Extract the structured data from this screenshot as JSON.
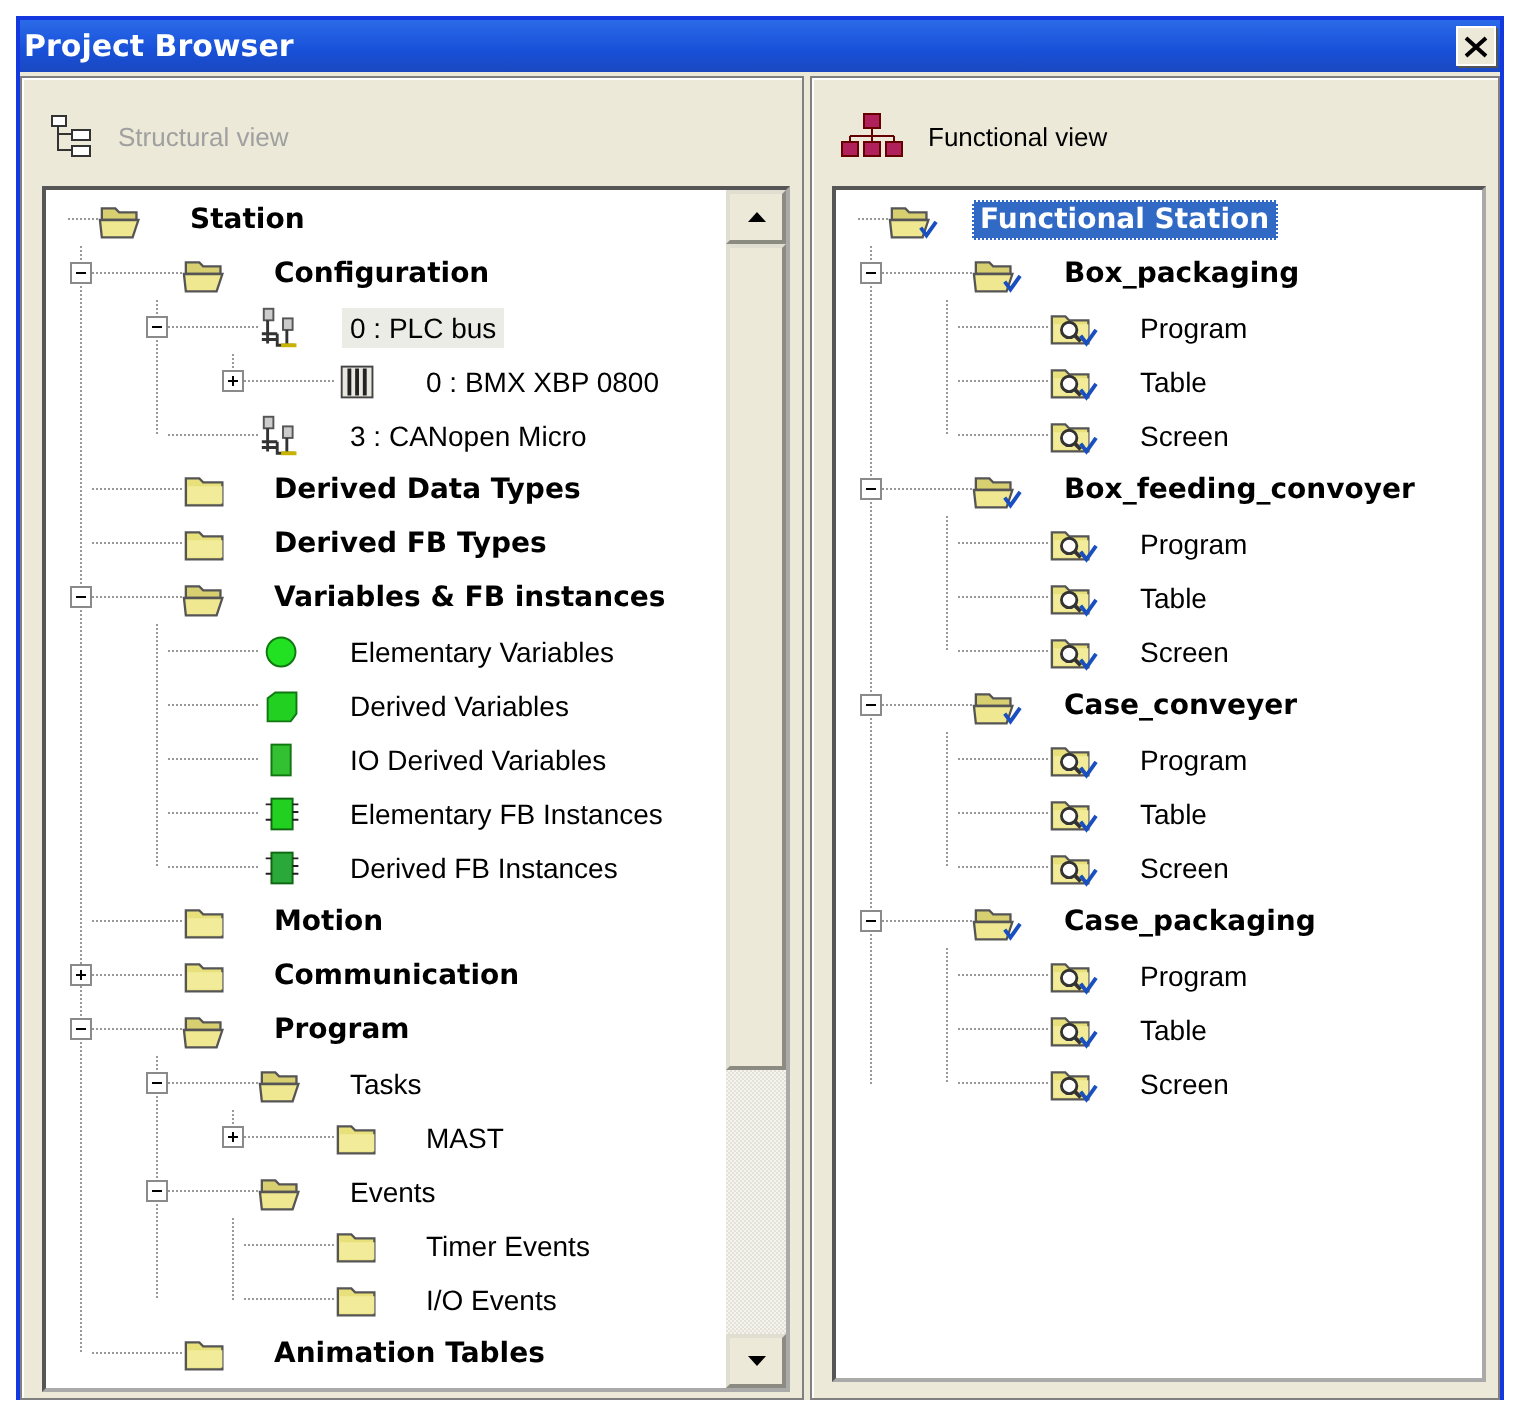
{
  "window": {
    "title": "Project Browser"
  },
  "panes": [
    {
      "title": "Structural view",
      "kind": "structural",
      "active": false,
      "scrollbar": true,
      "tree": [
        {
          "label": "Station",
          "kind": "folder-open",
          "selected": false,
          "children": [
            {
              "label": "Configuration",
              "kind": "folder-open",
              "expanded": true,
              "selected": false,
              "children": [
                {
                  "label": "0 : PLC bus",
                  "kind": "bus",
                  "expanded": true,
                  "selected": true,
                  "children": [
                    {
                      "label": "0 : BMX XBP 0800",
                      "kind": "rack",
                      "expanded": false,
                      "selected": false
                    }
                  ]
                },
                {
                  "label": "3 : CANopen Micro",
                  "kind": "bus",
                  "selected": false
                }
              ]
            },
            {
              "label": "Derived Data Types",
              "kind": "folder",
              "selected": false
            },
            {
              "label": "Derived FB Types",
              "kind": "folder",
              "selected": false
            },
            {
              "label": "Variables & FB instances",
              "kind": "folder-open",
              "expanded": true,
              "selected": false,
              "children": [
                {
                  "label": "Elementary Variables",
                  "kind": "circle",
                  "selected": false
                },
                {
                  "label": "Derived Variables",
                  "kind": "cube",
                  "selected": false
                },
                {
                  "label": "IO Derived Variables",
                  "kind": "block",
                  "selected": false
                },
                {
                  "label": "Elementary FB Instances",
                  "kind": "chip",
                  "selected": false
                },
                {
                  "label": "Derived FB Instances",
                  "kind": "chip-dark",
                  "selected": false
                }
              ]
            },
            {
              "label": "Motion",
              "kind": "folder",
              "selected": false
            },
            {
              "label": "Communication",
              "kind": "folder",
              "expanded": false,
              "selected": false
            },
            {
              "label": "Program",
              "kind": "folder-open",
              "expanded": true,
              "selected": false,
              "children": [
                {
                  "label": "Tasks",
                  "kind": "folder-open",
                  "expanded": true,
                  "selected": false,
                  "children": [
                    {
                      "label": "MAST",
                      "kind": "folder",
                      "expanded": false,
                      "selected": false
                    }
                  ]
                },
                {
                  "label": "Events",
                  "kind": "folder-open",
                  "expanded": true,
                  "selected": false,
                  "children": [
                    {
                      "label": "Timer Events",
                      "kind": "folder",
                      "selected": false
                    },
                    {
                      "label": "I/O Events",
                      "kind": "folder",
                      "selected": false
                    }
                  ]
                }
              ]
            },
            {
              "label": "Animation Tables",
              "kind": "folder",
              "selected": false
            }
          ]
        }
      ]
    },
    {
      "title": "Functional view",
      "kind": "functional",
      "active": true,
      "tree": [
        {
          "label": "Functional Station",
          "kind": "func-open",
          "selected": true,
          "children": [
            {
              "label": "Box_packaging",
              "kind": "func-open",
              "expanded": true,
              "selected": false,
              "children": [
                {
                  "label": "Program",
                  "kind": "func-item",
                  "selected": false
                },
                {
                  "label": "Table",
                  "kind": "func-item",
                  "selected": false
                },
                {
                  "label": "Screen",
                  "kind": "func-item",
                  "selected": false
                }
              ]
            },
            {
              "label": "Box_feeding_convoyer",
              "kind": "func-open",
              "expanded": true,
              "selected": false,
              "children": [
                {
                  "label": "Program",
                  "kind": "func-item",
                  "selected": false
                },
                {
                  "label": "Table",
                  "kind": "func-item",
                  "selected": false
                },
                {
                  "label": "Screen",
                  "kind": "func-item",
                  "selected": false
                }
              ]
            },
            {
              "label": "Case_conveyer",
              "kind": "func-open",
              "expanded": true,
              "selected": false,
              "children": [
                {
                  "label": "Program",
                  "kind": "func-item",
                  "selected": false
                },
                {
                  "label": "Table",
                  "kind": "func-item",
                  "selected": false
                },
                {
                  "label": "Screen",
                  "kind": "func-item",
                  "selected": false
                }
              ]
            },
            {
              "label": "Case_packaging",
              "kind": "func-open",
              "expanded": true,
              "selected": false,
              "children": [
                {
                  "label": "Program",
                  "kind": "func-item",
                  "selected": false
                },
                {
                  "label": "Table",
                  "kind": "func-item",
                  "selected": false
                },
                {
                  "label": "Screen",
                  "kind": "func-item",
                  "selected": false
                }
              ]
            }
          ]
        }
      ]
    }
  ]
}
